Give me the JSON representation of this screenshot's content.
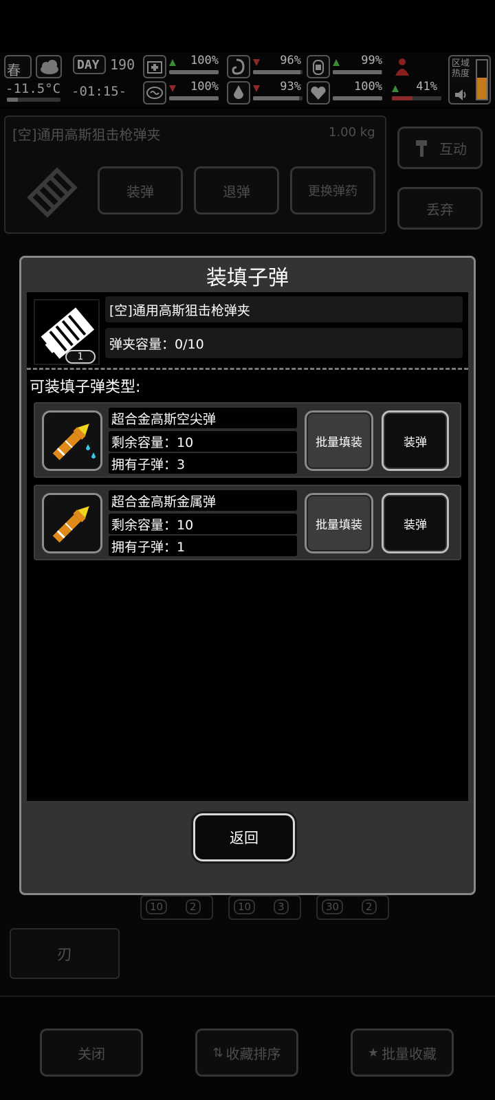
{
  "hud": {
    "season": "春",
    "temperature": "-11.5°C",
    "day_label": "DAY",
    "day_number": "190",
    "clock": "-01:15-",
    "stats": [
      {
        "pct": "100%",
        "trend": "up",
        "level": 1.0,
        "icon": "medkit-icon"
      },
      {
        "pct": "96%",
        "trend": "down",
        "level": 0.96,
        "icon": "stomach-icon"
      },
      {
        "pct": "99%",
        "trend": "up",
        "level": 0.99,
        "icon": "canteen-icon"
      },
      {
        "pct": "100%",
        "trend": "down",
        "level": 1.0,
        "icon": "brain-icon"
      },
      {
        "pct": "93%",
        "trend": "down",
        "level": 0.93,
        "icon": "water-drop-icon"
      },
      {
        "pct": "100%",
        "trend": "none",
        "level": 1.0,
        "icon": "heart-icon"
      },
      {
        "pct": "41%",
        "trend": "up",
        "level": 0.41,
        "icon": "body-icon"
      }
    ],
    "zone_heat_label": "区域热度",
    "colors": {
      "up": "#3a8a3a",
      "down": "#8a2a2a",
      "heat": "#c47a1a"
    }
  },
  "background": {
    "item_title": "[空]通用高斯狙击枪弹夹",
    "item_weight": "1.00 kg",
    "interact_label": "互动",
    "discard_label": "丢弃",
    "load_label": "装弹",
    "unload_label": "退弹",
    "change_ammo_label": "更换弹药",
    "list_badges": [
      [
        "10",
        "2"
      ],
      [
        "10",
        "3"
      ],
      [
        "30",
        "2"
      ]
    ],
    "blade_tab": "刃",
    "close_label": "关闭",
    "sort_fav_label": "收藏排序",
    "batch_fav_label": "批量收藏"
  },
  "dialog": {
    "title": "装填子弹",
    "magazine_name": "[空]通用高斯狙击枪弹夹",
    "capacity_text": "弹夹容量：0/10",
    "item_count": "1",
    "section_label": "可装填子弹类型:",
    "ammo": [
      {
        "name": "超合金高斯空尖弹",
        "remaining": "剩余容量：10",
        "owned": "拥有子弹：3",
        "batch_label": "批量填装",
        "load_label": "装弹",
        "icon": "hollow-point-bullet-icon"
      },
      {
        "name": "超合金高斯金属弹",
        "remaining": "剩余容量：10",
        "owned": "拥有子弹：1",
        "batch_label": "批量填装",
        "load_label": "装弹",
        "icon": "metal-bullet-icon"
      }
    ],
    "return_label": "返回"
  }
}
